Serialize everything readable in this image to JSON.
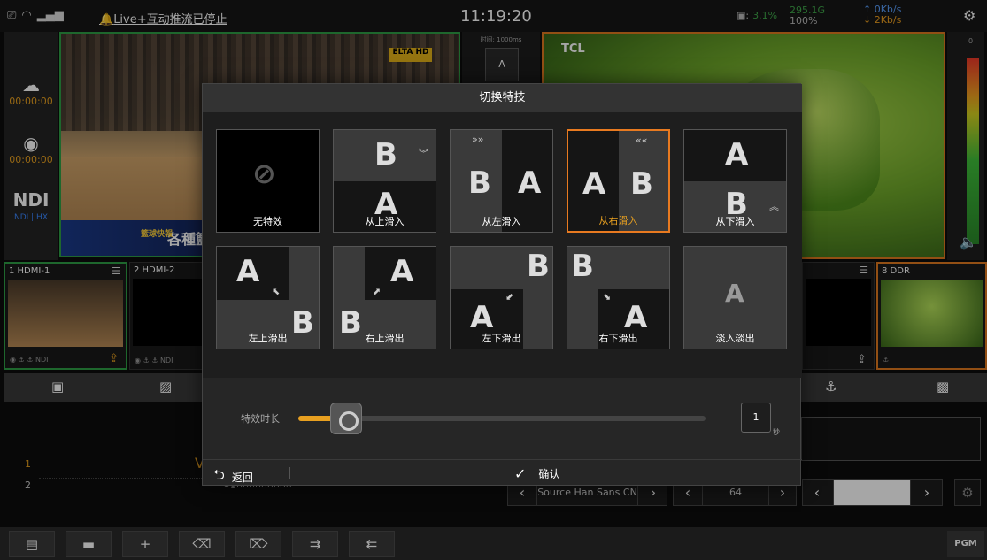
{
  "status": {
    "alert": "Live+互动推流已停止",
    "time": "11:19:20",
    "cpu": "3.1%",
    "mem_top": "295.1G",
    "mem_bottom": "100%",
    "net_up": "↑ 0Kb/s",
    "net_down": "↓ 2Kb/s"
  },
  "left_panel": {
    "stream_time": "00:00:00",
    "record_time": "00:00:00",
    "ndi_label": "NDI",
    "ndi_sub": "NDI | HX"
  },
  "preview": {
    "logo": "ELTA HD",
    "ticker": "各種籃",
    "ticker_small": "籃球快報"
  },
  "program": {
    "brand": "TCL"
  },
  "middle": {
    "duration_label": "时间: 1000ms",
    "btn_label": "A"
  },
  "meter": {
    "zero": "0"
  },
  "sources": [
    {
      "title": "1  HDMI-1",
      "foot": "◉ ⚓ ⚓ NDI"
    },
    {
      "title": "2  HDMI-2",
      "foot": "◉ ⚓ ⚓ NDI"
    },
    {
      "title": "8  DDR",
      "foot": "⚓"
    }
  ],
  "lower": {
    "row1": "1",
    "row2": "2",
    "row_v": "V",
    "row_g": "Ughhhhhhhhh"
  },
  "controls": {
    "font": "Source Han Sans CN",
    "size": "64",
    "color_value": ""
  },
  "toolbar": {
    "pgm": "PGM"
  },
  "dialog": {
    "title": "切换特技",
    "tiles": [
      {
        "label": "无特效"
      },
      {
        "label": "从上滑入"
      },
      {
        "label": "从左滑入"
      },
      {
        "label": "从右滑入"
      },
      {
        "label": "从下滑入"
      },
      {
        "label": "左上滑出"
      },
      {
        "label": "右上滑出"
      },
      {
        "label": "左下滑出"
      },
      {
        "label": "右下滑出"
      },
      {
        "label": "淡入淡出"
      }
    ],
    "duration_label": "特效时长",
    "duration_value": "1",
    "duration_unit": "秒",
    "back": "返回",
    "confirm": "确认"
  },
  "colors": {
    "accent": "#e8a020",
    "preview_border": "#2e9e46",
    "program_border": "#e07a20"
  }
}
